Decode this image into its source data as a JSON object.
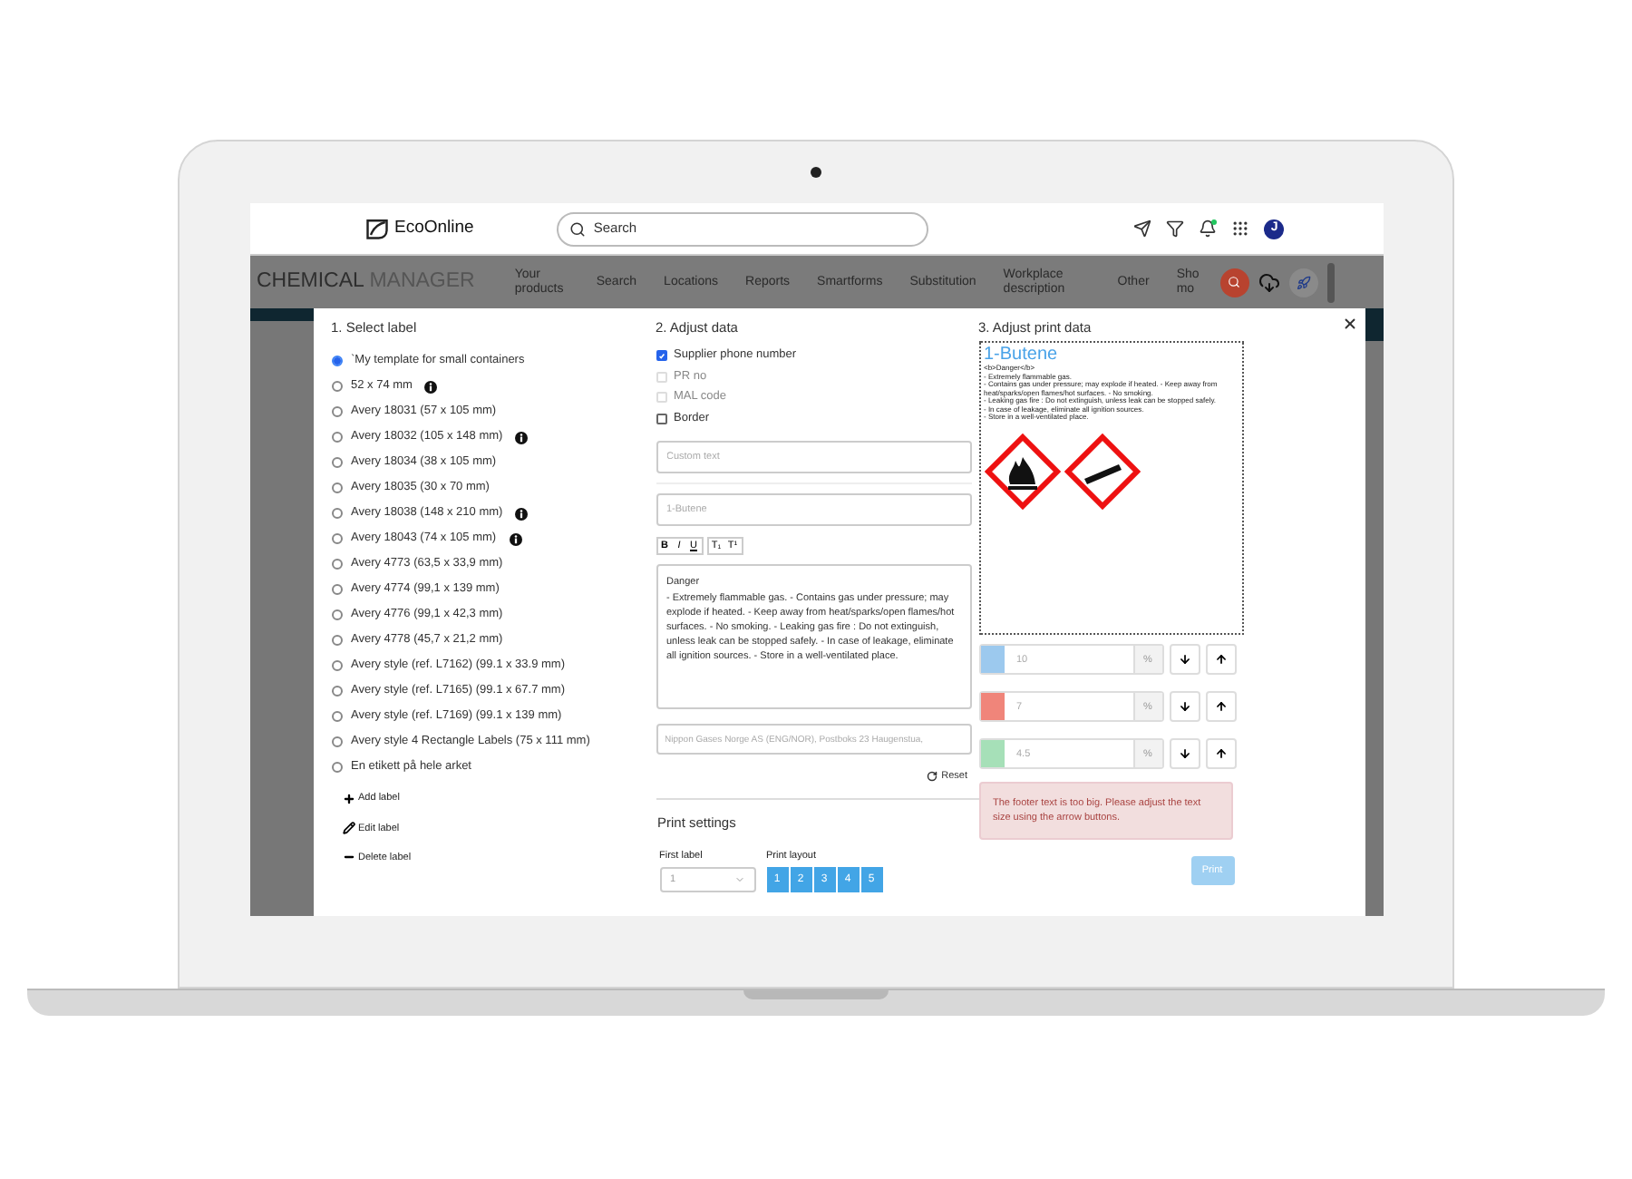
{
  "topbar": {
    "logo": "EcoOnline",
    "search": {
      "placeholder": "Search"
    },
    "avatar": "J"
  },
  "navbar": {
    "title_main": "CHEMICAL",
    "title_sub": "MANAGER",
    "items": [
      {
        "label": "Your products"
      },
      {
        "label": "Search"
      },
      {
        "label": "Locations"
      },
      {
        "label": "Reports"
      },
      {
        "label": "Smartforms"
      },
      {
        "label": "Substitution"
      },
      {
        "label": "Workplace description"
      },
      {
        "label": "Other"
      },
      {
        "label": "Sho mo"
      }
    ]
  },
  "dialog": {
    "select_label": {
      "heading": "1. Select label",
      "options": [
        {
          "label": "`My template for small containers",
          "selected": true,
          "info": false
        },
        {
          "label": "52 x 74 mm",
          "selected": false,
          "info": true
        },
        {
          "label": "Avery 18031 (57 x 105 mm)",
          "selected": false,
          "info": false
        },
        {
          "label": "Avery 18032 (105 x 148 mm)",
          "selected": false,
          "info": true
        },
        {
          "label": "Avery 18034 (38 x 105 mm)",
          "selected": false,
          "info": false
        },
        {
          "label": "Avery 18035 (30 x 70 mm)",
          "selected": false,
          "info": false
        },
        {
          "label": "Avery 18038 (148 x 210 mm)",
          "selected": false,
          "info": true
        },
        {
          "label": "Avery 18043 (74 x 105 mm)",
          "selected": false,
          "info": true
        },
        {
          "label": "Avery 4773 (63,5 x 33,9 mm)",
          "selected": false,
          "info": false
        },
        {
          "label": "Avery 4774 (99,1 x 139 mm)",
          "selected": false,
          "info": false
        },
        {
          "label": "Avery 4776 (99,1 x 42,3 mm)",
          "selected": false,
          "info": false
        },
        {
          "label": "Avery 4778 (45,7 x 21,2 mm)",
          "selected": false,
          "info": false
        },
        {
          "label": "Avery style (ref. L7162) (99.1 x 33.9 mm)",
          "selected": false,
          "info": false
        },
        {
          "label": "Avery style (ref. L7165) (99.1 x 67.7 mm)",
          "selected": false,
          "info": false
        },
        {
          "label": "Avery style (ref. L7169) (99.1 x 139 mm)",
          "selected": false,
          "info": false
        },
        {
          "label": "Avery style 4 Rectangle Labels (75 x 111 mm)",
          "selected": false,
          "info": false
        },
        {
          "label": "En etikett på hele arket",
          "selected": false,
          "info": false
        }
      ],
      "actions": [
        {
          "kind": "add",
          "label": "Add label"
        },
        {
          "kind": "edit",
          "label": "Edit label"
        },
        {
          "kind": "delete",
          "label": "Delete label"
        }
      ]
    },
    "adjust_data": {
      "heading": "2. Adjust data",
      "checkboxes": [
        {
          "label": "Supplier phone number",
          "checked": true,
          "disabled": false
        },
        {
          "label": "PR no",
          "checked": false,
          "disabled": true
        },
        {
          "label": "MAL code",
          "checked": false,
          "disabled": true
        },
        {
          "label": "Border",
          "checked": false,
          "disabled": false
        }
      ],
      "custom_text": {
        "placeholder": "Custom text"
      },
      "name_field": {
        "placeholder": "1-Butene"
      },
      "toolbar": [
        "B",
        "I",
        "U",
        "T₁",
        "T¹"
      ],
      "editor": {
        "title": "Danger",
        "body": "- Extremely flammable gas. - Contains gas under pressure; may explode if heated. - Keep away from heat/sparks/open flames/hot surfaces. - No smoking. - Leaking gas fire : Do not extinguish, unless leak can be stopped safely. - In case of leakage, eliminate all ignition sources. - Store in a well-ventilated place."
      },
      "footer_field": {
        "placeholder": "Nippon Gases Norge AS (ENG/NOR), Postboks 23 Haugenstua, "
      },
      "reset": "Reset",
      "print_settings": {
        "heading": "Print settings",
        "first_label": {
          "label": "First label",
          "value": "1"
        },
        "print_layout": {
          "label": "Print layout",
          "options": [
            "1",
            "2",
            "3",
            "4",
            "5"
          ]
        }
      }
    },
    "print_data": {
      "heading": "3. Adjust print data",
      "preview": {
        "title": "1-Butene",
        "lines": [
          "<b>Danger</b>",
          "- Extremely flammable gas.",
          "- Contains gas under pressure; may explode if heated.  - Keep away from heat/sparks/open flames/hot surfaces. - No smoking.",
          "- Leaking gas fire : Do not extinguish, unless leak can be stopped safely.",
          "- In case of leakage, eliminate all ignition sources.",
          "- Store in a well-ventilated place."
        ]
      },
      "sizes": [
        {
          "color": "#9cc9ee",
          "value": "10",
          "unit": "%"
        },
        {
          "color": "#f0857a",
          "value": "7",
          "unit": "%"
        },
        {
          "color": "#a6e0b8",
          "value": "4.5",
          "unit": "%"
        }
      ],
      "alert": "The footer text is too big. Please adjust the text size using the arrow buttons.",
      "print_button": {
        "label": "Print",
        "disabled": true
      }
    }
  }
}
